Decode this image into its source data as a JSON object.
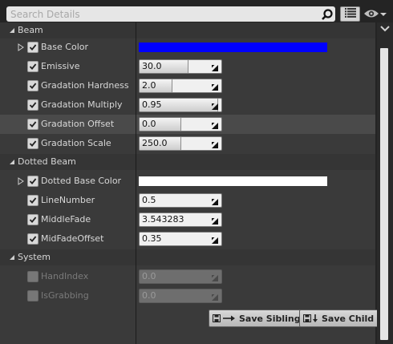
{
  "search": {
    "placeholder": "Search Details",
    "value": ""
  },
  "toolbar": {
    "view_options_icon": "grid-list-icon",
    "visibility_icon": "eye-icon"
  },
  "sections": [
    {
      "title": "Beam",
      "expanded": true
    },
    {
      "title": "Dotted Beam",
      "expanded": true
    },
    {
      "title": "System",
      "expanded": true
    }
  ],
  "beam": {
    "base_color": {
      "label": "Base Color",
      "checked": true,
      "color": "#0000ff"
    },
    "emissive": {
      "label": "Emissive",
      "checked": true,
      "value": "30.0",
      "fill": 0.59
    },
    "gradation_hardness": {
      "label": "Gradation Hardness",
      "checked": true,
      "value": "2.0",
      "fill": 0.39
    },
    "gradation_multiply": {
      "label": "Gradation Multiply",
      "checked": true,
      "value": "0.95",
      "fill": 0.95
    },
    "gradation_offset": {
      "label": "Gradation Offset",
      "checked": true,
      "value": "0.0",
      "fill": 0.5
    },
    "gradation_scale": {
      "label": "Gradation Scale",
      "checked": true,
      "value": "250.0",
      "fill": 0.5
    }
  },
  "dotted": {
    "base_color": {
      "label": "Dotted Base Color",
      "checked": true,
      "color": "#ffffff"
    },
    "line_number": {
      "label": "LineNumber",
      "checked": true,
      "value": "0.5"
    },
    "middle_fade": {
      "label": "MiddleFade",
      "checked": true,
      "value": "3.543283"
    },
    "mid_fade_offset": {
      "label": "MidFadeOffset",
      "checked": true,
      "value": "0.35"
    }
  },
  "system": {
    "hand_index": {
      "label": "HandIndex",
      "checked": false,
      "enabled": false,
      "value": "0.0"
    },
    "is_grabbing": {
      "label": "IsGrabbing",
      "checked": false,
      "enabled": false,
      "value": "0.0"
    }
  },
  "buttons": {
    "save_sibling": "Save Sibling",
    "save_child": "Save Child"
  },
  "colors": {
    "accent_blue": "#0000ff",
    "panel_bg": "#3a3a3a",
    "highlight_row": "#4a4a4a"
  }
}
